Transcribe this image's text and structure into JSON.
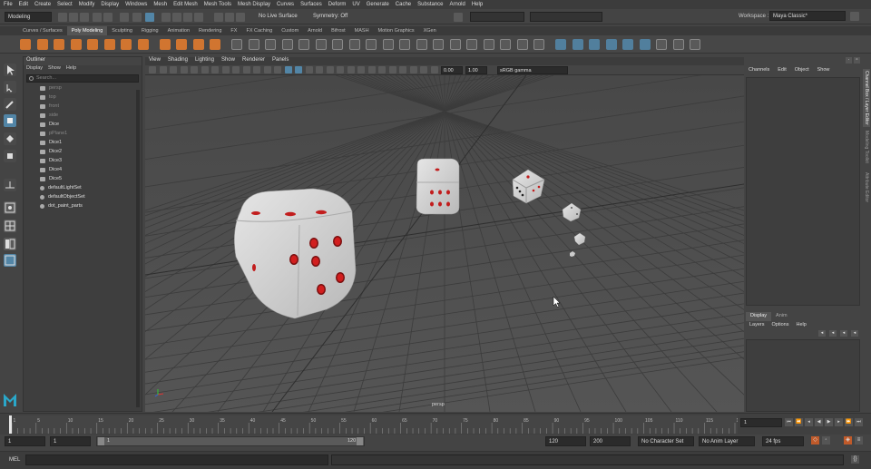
{
  "menubar": [
    "File",
    "Edit",
    "Create",
    "Select",
    "Modify",
    "Display",
    "Windows",
    "Mesh",
    "Edit Mesh",
    "Mesh Tools",
    "Mesh Display",
    "Curves",
    "Surfaces",
    "Deform",
    "UV",
    "Generate",
    "Cache",
    "Substance",
    "Arnold",
    "Help"
  ],
  "status": {
    "mode": "Modeling",
    "live_surface": "No Live Surface",
    "symmetry": "Symmetry: Off",
    "workspace_label": "Workspace :",
    "workspace": "Maya Classic*"
  },
  "shelf_tabs": [
    "Curves / Surfaces",
    "Poly Modeling",
    "Sculpting",
    "Rigging",
    "Animation",
    "Rendering",
    "FX",
    "FX Caching",
    "Custom",
    "Arnold",
    "Bifrost",
    "MASH",
    "Motion Graphics",
    "XGen"
  ],
  "shelf_active": "Poly Modeling",
  "outliner": {
    "title": "Outliner",
    "menu": [
      "Display",
      "Show",
      "Help"
    ],
    "search_placeholder": "Search...",
    "items": [
      {
        "label": "persp",
        "dim": true
      },
      {
        "label": "top",
        "dim": true
      },
      {
        "label": "front",
        "dim": true
      },
      {
        "label": "side",
        "dim": true
      },
      {
        "label": "Dice",
        "dim": false
      },
      {
        "label": "pPlane1",
        "dim": true
      },
      {
        "label": "Dice1",
        "dim": false
      },
      {
        "label": "Dice2",
        "dim": false
      },
      {
        "label": "Dice3",
        "dim": false
      },
      {
        "label": "Dice4",
        "dim": false
      },
      {
        "label": "Dice5",
        "dim": false
      },
      {
        "label": "defaultLightSet",
        "dim": false
      },
      {
        "label": "defaultObjectSet",
        "dim": false
      },
      {
        "label": "dot_paint_parts",
        "dim": false
      }
    ]
  },
  "viewport": {
    "menu": [
      "View",
      "Shading",
      "Lighting",
      "Show",
      "Renderer",
      "Panels"
    ],
    "field1": "0.00",
    "field2": "1.00",
    "colorspace": "sRGB gamma",
    "camera_label": "persp"
  },
  "channel_box": {
    "side_tabs": [
      "Channel Box / Layer Editor",
      "Modeling Toolkit",
      "Attribute Editor"
    ],
    "menu": [
      "Channels",
      "Edit",
      "Object",
      "Show"
    ]
  },
  "layer_editor": {
    "tabs": [
      "Display",
      "Anim"
    ],
    "menu": [
      "Layers",
      "Options",
      "Help"
    ]
  },
  "timeline": {
    "ticks": [
      "1",
      "5",
      "10",
      "15",
      "20",
      "25",
      "30",
      "35",
      "40",
      "45",
      "50",
      "55",
      "60",
      "65",
      "70",
      "75",
      "80",
      "85",
      "90",
      "95",
      "100",
      "105",
      "110",
      "115",
      "120"
    ],
    "current_frame": "1"
  },
  "range": {
    "start": "1",
    "playback_start": "1",
    "slider_start": "1",
    "slider_end": "120",
    "playback_end": "120",
    "end": "200",
    "character_set": "No Character Set",
    "anim_layer": "No Anim Layer",
    "fps": "24 fps"
  },
  "mel_label": "MEL",
  "colors": {
    "accent": "#e07a2e",
    "select_blue": "#5285a6",
    "pip_red": "#d21e1e"
  }
}
